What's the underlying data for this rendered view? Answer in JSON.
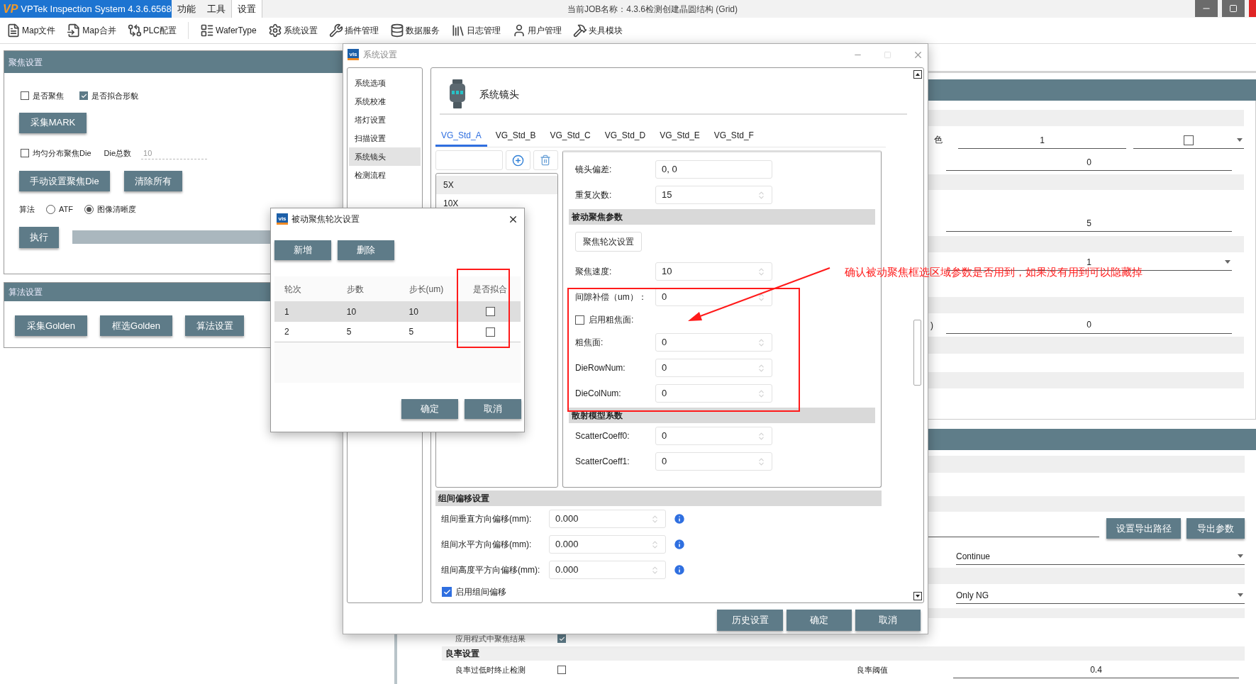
{
  "main_window": {
    "logo": "VP",
    "title": "VPTek Inspection System 4.3.6.6568",
    "job": "当前JOB名称：4.3.6检测创建晶圆结构 (Grid)",
    "menu": [
      {
        "label": "功能",
        "selected": false
      },
      {
        "label": "工具",
        "selected": false
      },
      {
        "label": "设置",
        "selected": true
      }
    ]
  },
  "toolbar": [
    {
      "label": "Map文件"
    },
    {
      "label": "Map合并"
    },
    {
      "label": "PLC配置"
    },
    {
      "label": "WaferType"
    },
    {
      "label": "系统设置"
    },
    {
      "label": "插件管理"
    },
    {
      "label": "数据服务"
    },
    {
      "label": "日志管理"
    },
    {
      "label": "用户管理"
    },
    {
      "label": "夹具模块"
    }
  ],
  "focus_panel": {
    "title": "聚焦设置",
    "checks": [
      {
        "label": "是否聚焦",
        "checked": false
      },
      {
        "label": "是否拟合形貌",
        "checked": true
      }
    ],
    "collect_button": "采集MARK",
    "uniform": {
      "label": "均匀分布聚焦Die",
      "checked": false
    },
    "die_total_label": "Die总数",
    "die_total": "10",
    "buttons": [
      "手动设置聚焦Die",
      "清除所有"
    ],
    "algorithm_label": "算法",
    "radios": [
      {
        "label": "ATF",
        "selected": false
      },
      {
        "label": "图像清晰度",
        "selected": true
      }
    ],
    "run_button": "执行",
    "progress": {
      "level": 0
    }
  },
  "algo_panel": {
    "title": "算法设置",
    "buttons": [
      "采集Golden",
      "框选Golden",
      "算法设置"
    ]
  },
  "right_panel": {
    "color_row": {
      "label": "色",
      "value": "1",
      "checked": false
    },
    "rows": [
      {
        "kind": "field",
        "value": "0"
      },
      {
        "kind": "field",
        "value": "5"
      },
      {
        "kind": "dropdown",
        "value": "1"
      },
      {
        "kind": "field",
        "label": ")",
        "value": "0"
      }
    ],
    "export_buttons": [
      "设置导出路径",
      "导出参数"
    ],
    "dropdowns": [
      "Continue",
      "Only NG"
    ],
    "apply": {
      "label": "应用程式中聚焦结果",
      "checked": true
    },
    "yield_section": "良率设置",
    "stop": {
      "label": "良率过低时终止检测",
      "checked": false
    },
    "threshold_label": "良率阈值",
    "threshold": "0.4"
  },
  "settings_dialog": {
    "logo": "vis",
    "title": "系统设置",
    "nav": [
      {
        "label": "系统选项",
        "selected": false
      },
      {
        "label": "系统校准",
        "selected": false
      },
      {
        "label": "塔灯设置",
        "selected": false
      },
      {
        "label": "扫描设置",
        "selected": false
      },
      {
        "label": "系统镜头",
        "selected": true
      },
      {
        "label": "检测流程",
        "selected": false
      }
    ],
    "heading": "系统镜头",
    "tabs": [
      {
        "label": "VG_Std_A",
        "selected": true
      },
      {
        "label": "VG_Std_B",
        "selected": false
      },
      {
        "label": "VG_Std_C",
        "selected": false
      },
      {
        "label": "VG_Std_D",
        "selected": false
      },
      {
        "label": "VG_Std_E",
        "selected": false
      },
      {
        "label": "VG_Std_F",
        "selected": false
      }
    ],
    "lenses": [
      {
        "label": "5X",
        "selected": true
      },
      {
        "label": "10X",
        "selected": false
      }
    ],
    "params": [
      {
        "kind": "text",
        "label": "镜头偏差:",
        "value": "0, 0"
      },
      {
        "kind": "spin",
        "label": "重复次数:",
        "value": "15"
      },
      {
        "kind": "section",
        "label": "被动聚焦参数"
      },
      {
        "kind": "button",
        "label": "聚焦轮次设置"
      },
      {
        "kind": "spin",
        "label": "聚焦速度:",
        "value": "10"
      },
      {
        "kind": "spin",
        "label": "间隙补偿（um）：",
        "value": "0"
      },
      {
        "kind": "check",
        "label": "启用粗焦面:",
        "checked": false
      },
      {
        "kind": "spin",
        "label": "粗焦面:",
        "value": "0"
      },
      {
        "kind": "spin",
        "label": "DieRowNum:",
        "value": "0"
      },
      {
        "kind": "spin",
        "label": "DieColNum:",
        "value": "0"
      },
      {
        "kind": "section",
        "label": "散射模型系数"
      },
      {
        "kind": "spin",
        "label": "ScatterCoeff0:",
        "value": "0"
      },
      {
        "kind": "spin",
        "label": "ScatterCoeff1:",
        "value": "0"
      }
    ],
    "offset_section": "组间偏移设置",
    "offsets": [
      {
        "label": "组间垂直方向偏移(mm):",
        "value": "0.000"
      },
      {
        "label": "组间水平方向偏移(mm):",
        "value": "0.000"
      },
      {
        "label": "组间高度平方向偏移(mm):",
        "value": "0.000"
      }
    ],
    "offset_enable": {
      "label": "启用组间偏移",
      "checked": true
    },
    "buttons": [
      "历史设置",
      "确定",
      "取消"
    ]
  },
  "rounds_dialog": {
    "logo": "vis",
    "title": "被动聚焦轮次设置",
    "buttons": [
      "新增",
      "删除"
    ],
    "columns": [
      "轮次",
      "步数",
      "步长(um)",
      "是否拟合"
    ],
    "rows": [
      {
        "cells": [
          "1",
          "10",
          "10"
        ],
        "fit": false,
        "selected": true
      },
      {
        "cells": [
          "2",
          "5",
          "5"
        ],
        "fit": false,
        "selected": false
      }
    ],
    "footer_buttons": [
      "确定",
      "取消"
    ]
  },
  "annotation": {
    "text": "确认被动聚焦框选区域参数是否用到，如果没有用到可以隐藏掉"
  }
}
